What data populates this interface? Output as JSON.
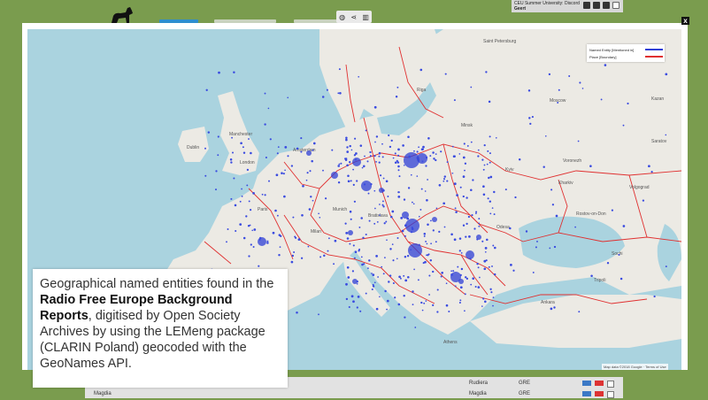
{
  "header": {
    "view_icons": [
      "◍",
      "⋖",
      "▥"
    ],
    "user": {
      "line1": "CEU Summer University: Discord",
      "line2": "Geert"
    }
  },
  "background_table": {
    "rows": [
      {
        "name": "",
        "place": "Rudiera",
        "code": "GRE"
      },
      {
        "name": "Magdia",
        "place": "Magdia",
        "code": "GRE"
      }
    ]
  },
  "modal": {
    "close_label": "x"
  },
  "map": {
    "legend": [
      {
        "label": "Named Entity [Mentioned in]",
        "color": "#2f3fd6"
      },
      {
        "label": "Place [Boundary]",
        "color": "#e03030"
      }
    ],
    "attribution": "Map data ©2018 Google · Terms of Use",
    "cities": [
      "Dublin",
      "Manchester",
      "London",
      "Amsterdam",
      "Paris",
      "Munich",
      "Bratislava",
      "Moscow",
      "Kazan",
      "Kharkiv",
      "Voronezh",
      "Saratov",
      "Odesa",
      "Rostov-on-Don",
      "Ankara",
      "Athens",
      "Milan",
      "Saint Petersburg",
      "Minsk",
      "Riga",
      "Kyiv",
      "Volgograd",
      "Sochi",
      "Tripoli"
    ],
    "colors": {
      "water": "#aad3df",
      "land": "#eceae4",
      "boundary": "#e03030",
      "entity": "#2f3fd6"
    }
  },
  "caption": {
    "part1": "Geographical named entities found in the ",
    "bold": "Radio Free Europe Background Reports",
    "part2": ", digitised by Open Society Archives by using the LEMeng package (CLARIN Poland) geocoded with the GeoNames API."
  }
}
